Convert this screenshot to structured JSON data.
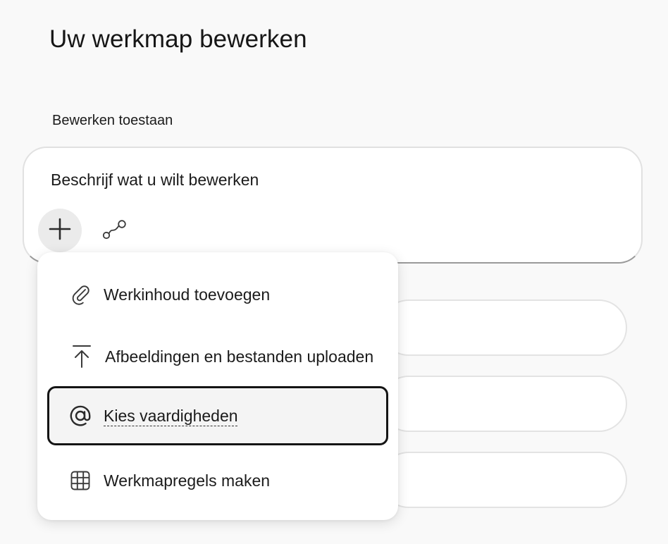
{
  "page": {
    "title": "Uw werkmap bewerken"
  },
  "editor": {
    "section_label": "Bewerken toestaan",
    "composer": {
      "placeholder": "Beschrijf wat u wilt bewerken",
      "plus_icon": "plus-icon",
      "connect_icon": "connector-icon"
    }
  },
  "menu": {
    "items": [
      {
        "label": "Werkinhoud toevoegen",
        "icon": "paperclip-icon",
        "selected": false
      },
      {
        "label": "Afbeeldingen en bestanden uploaden",
        "icon": "upload-icon",
        "selected": false
      },
      {
        "label": "Kies vaardigheden",
        "icon": "at-sign-icon",
        "selected": true
      },
      {
        "label": "Werkmapregels maken",
        "icon": "grid-icon",
        "selected": false
      }
    ]
  },
  "colors": {
    "page_background": "#f9f9f9",
    "surface": "#ffffff",
    "selected_border": "#141414",
    "selected_background": "#f4f4f4",
    "plus_button_background": "#ebebeb"
  }
}
